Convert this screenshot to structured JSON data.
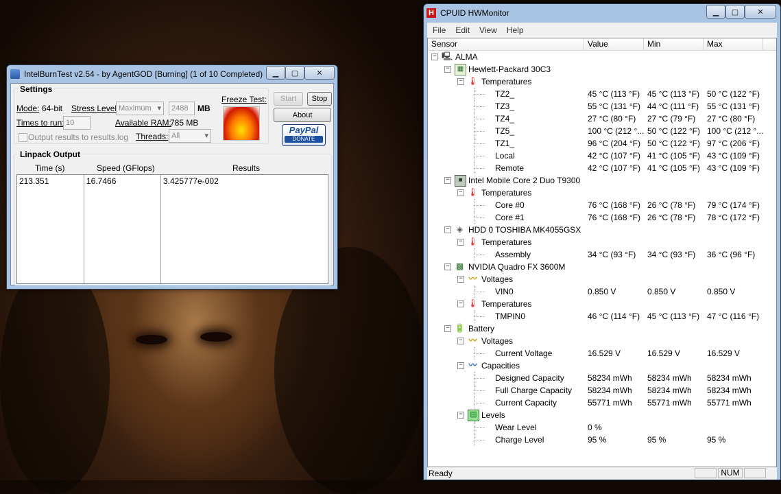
{
  "ibt": {
    "title": "IntelBurnTest v2.54 - by AgentGOD [Burning] (1 of 10 Completed)",
    "settings_label": "Settings",
    "mode_label": "Mode:",
    "mode_value": "64-bit",
    "stress_label": "Stress Level:",
    "stress_value": "Maximum",
    "mem_value": "2488",
    "mem_unit": "MB",
    "times_label": "Times to run:",
    "times_value": "10",
    "ram_label": "Available RAM:",
    "ram_value": "785 MB",
    "output_check_label": "Output results to results.log",
    "threads_label": "Threads:",
    "threads_value": "All",
    "freeze_label": "Freeze Test:",
    "start_label": "Start",
    "stop_label": "Stop",
    "about_label": "About",
    "paypal_label": "PayPal",
    "donate_label": "DONATE",
    "linpack_label": "Linpack Output",
    "columns": [
      "Time (s)",
      "Speed (GFlops)",
      "Results"
    ],
    "rows": [
      [
        "213.351",
        "16.7466",
        "3.425777e-002"
      ]
    ]
  },
  "hwm": {
    "title": "CPUID HWMonitor",
    "menu": [
      "File",
      "Edit",
      "View",
      "Help"
    ],
    "columns": [
      "Sensor",
      "Value",
      "Min",
      "Max"
    ],
    "status": "Ready",
    "num_label": "NUM",
    "rows": [
      {
        "level": 0,
        "toggle": "−",
        "icon": "computer-icon",
        "label": "ALMA"
      },
      {
        "level": 1,
        "toggle": "−",
        "icon": "motherboard-icon",
        "label": "Hewlett-Packard 30C3"
      },
      {
        "level": 2,
        "toggle": "−",
        "icon": "thermometer-icon",
        "label": "Temperatures"
      },
      {
        "level": 3,
        "label": "TZ2_",
        "value": "45 °C (113 °F)",
        "min": "45 °C (113 °F)",
        "max": "50 °C (122 °F)"
      },
      {
        "level": 3,
        "label": "TZ3_",
        "value": "55 °C (131 °F)",
        "min": "44 °C (111 °F)",
        "max": "55 °C (131 °F)"
      },
      {
        "level": 3,
        "label": "TZ4_",
        "value": "27 °C (80 °F)",
        "min": "27 °C (79 °F)",
        "max": "27 °C (80 °F)"
      },
      {
        "level": 3,
        "label": "TZ5_",
        "value": "100 °C (212 °...",
        "min": "50 °C (122 °F)",
        "max": "100 °C (212 °..."
      },
      {
        "level": 3,
        "label": "TZ1_",
        "value": "96 °C (204 °F)",
        "min": "50 °C (122 °F)",
        "max": "97 °C (206 °F)"
      },
      {
        "level": 3,
        "label": "Local",
        "value": "42 °C (107 °F)",
        "min": "41 °C (105 °F)",
        "max": "43 °C (109 °F)"
      },
      {
        "level": 3,
        "label": "Remote",
        "value": "42 °C (107 °F)",
        "min": "41 °C (105 °F)",
        "max": "43 °C (109 °F)"
      },
      {
        "level": 1,
        "toggle": "−",
        "icon": "cpu-icon",
        "label": "Intel Mobile Core 2 Duo T9300"
      },
      {
        "level": 2,
        "toggle": "−",
        "icon": "thermometer-icon",
        "label": "Temperatures"
      },
      {
        "level": 3,
        "label": "Core #0",
        "value": "76 °C (168 °F)",
        "min": "26 °C (78 °F)",
        "max": "79 °C (174 °F)"
      },
      {
        "level": 3,
        "label": "Core #1",
        "value": "76 °C (168 °F)",
        "min": "26 °C (78 °F)",
        "max": "78 °C (172 °F)"
      },
      {
        "level": 1,
        "toggle": "−",
        "icon": "hdd-icon",
        "label": "HDD 0 TOSHIBA MK4055GSX"
      },
      {
        "level": 2,
        "toggle": "−",
        "icon": "thermometer-icon",
        "label": "Temperatures"
      },
      {
        "level": 3,
        "label": "Assembly",
        "value": "34 °C (93 °F)",
        "min": "34 °C (93 °F)",
        "max": "36 °C (96 °F)"
      },
      {
        "level": 1,
        "toggle": "−",
        "icon": "gpu-icon",
        "label": "NVIDIA Quadro FX 3600M"
      },
      {
        "level": 2,
        "toggle": "−",
        "icon": "voltage-icon",
        "label": "Voltages"
      },
      {
        "level": 3,
        "label": "VIN0",
        "value": "0.850 V",
        "min": "0.850 V",
        "max": "0.850 V"
      },
      {
        "level": 2,
        "toggle": "−",
        "icon": "thermometer-icon",
        "label": "Temperatures"
      },
      {
        "level": 3,
        "label": "TMPIN0",
        "value": "46 °C (114 °F)",
        "min": "45 °C (113 °F)",
        "max": "47 °C (116 °F)"
      },
      {
        "level": 1,
        "toggle": "−",
        "icon": "battery-icon",
        "label": "Battery"
      },
      {
        "level": 2,
        "toggle": "−",
        "icon": "voltage-icon",
        "label": "Voltages"
      },
      {
        "level": 3,
        "label": "Current Voltage",
        "value": "16.529 V",
        "min": "16.529 V",
        "max": "16.529 V"
      },
      {
        "level": 2,
        "toggle": "−",
        "icon": "capacity-icon",
        "label": "Capacities"
      },
      {
        "level": 3,
        "label": "Designed Capacity",
        "value": "58234 mWh",
        "min": "58234 mWh",
        "max": "58234 mWh"
      },
      {
        "level": 3,
        "label": "Full Charge Capacity",
        "value": "58234 mWh",
        "min": "58234 mWh",
        "max": "58234 mWh"
      },
      {
        "level": 3,
        "label": "Current Capacity",
        "value": "55771 mWh",
        "min": "55771 mWh",
        "max": "55771 mWh"
      },
      {
        "level": 2,
        "toggle": "−",
        "icon": "levels-icon",
        "label": "Levels"
      },
      {
        "level": 3,
        "label": "Wear Level",
        "value": "0 %",
        "min": "",
        "max": ""
      },
      {
        "level": 3,
        "label": "Charge Level",
        "value": "95 %",
        "min": "95 %",
        "max": "95 %"
      }
    ]
  }
}
